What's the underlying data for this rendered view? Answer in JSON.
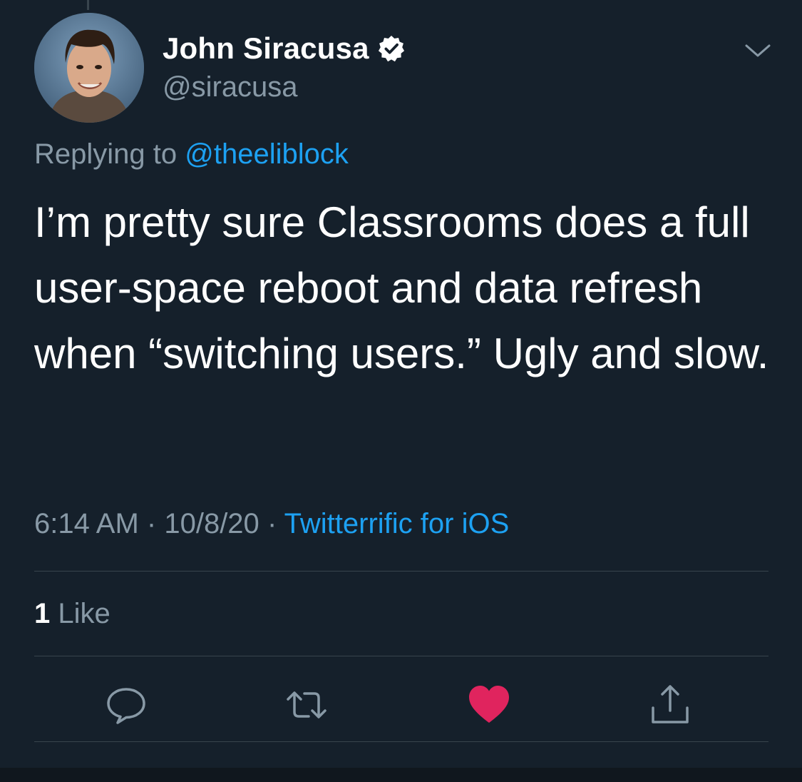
{
  "tweet": {
    "author": {
      "display_name": "John Siracusa",
      "handle": "@siracusa",
      "verified": true,
      "avatar_icon": "user-photo"
    },
    "replying_label": "Replying to",
    "replying_to": "@theeliblock",
    "text": "I’m pretty sure Classrooms does a full user-space reboot and data refresh when “switching users.” Ugly and slow.",
    "time": "6:14 AM",
    "date": "10/8/20",
    "separator": "·",
    "source": "Twitterrific for iOS",
    "like_count": "1",
    "like_label": "Like"
  },
  "actions": [
    {
      "name": "reply",
      "icon": "speech-bubble-icon"
    },
    {
      "name": "retweet",
      "icon": "retweet-icon"
    },
    {
      "name": "like",
      "icon": "heart-icon",
      "active": true
    },
    {
      "name": "share",
      "icon": "share-icon"
    }
  ],
  "colors": {
    "background": "#15202b",
    "accent": "#1da1f2",
    "secondary_text": "#8899a6",
    "divider": "#38444d",
    "like_active": "#e0245e"
  }
}
